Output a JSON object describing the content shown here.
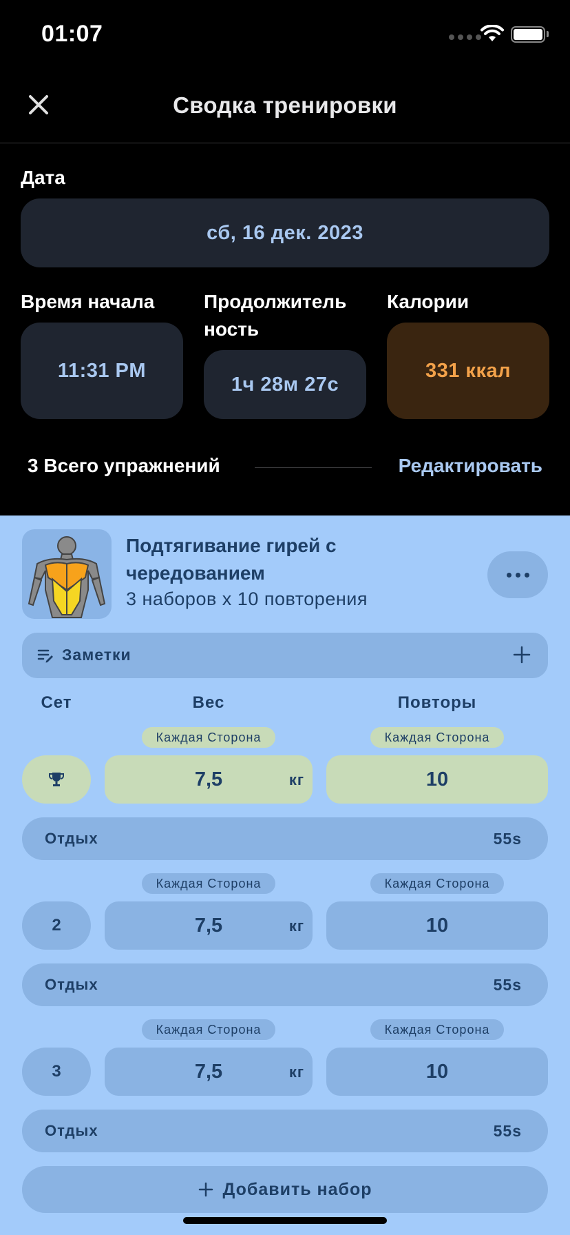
{
  "status_bar": {
    "time": "01:07"
  },
  "nav": {
    "title": "Сводка тренировки"
  },
  "date": {
    "label": "Дата",
    "value": "сб, 16 дек. 2023"
  },
  "stats": {
    "start_label": "Время начала",
    "start_value": "11:31 PM",
    "duration_label_1": "Продолжитель",
    "duration_label_2": "ность",
    "duration_value": "1ч 28м 27с",
    "calories_label": "Калории",
    "calories_value": "331 ккал"
  },
  "summary": {
    "total_label": "3 Всего упражнений",
    "edit_label": "Редактировать"
  },
  "exercise": {
    "title": "Подтягивание гирей с чередованием",
    "subtitle": "3 наборов x 10 повторения",
    "notes_label": "Заметки",
    "headers": {
      "set": "Сет",
      "weight": "Вес",
      "reps": "Повторы"
    },
    "side_tag": "Каждая Сторона",
    "unit": "кг",
    "sets": [
      {
        "set": "",
        "weight": "7,5",
        "reps": "10",
        "rest_label": "Отдых",
        "rest": "55s"
      },
      {
        "set": "2",
        "weight": "7,5",
        "reps": "10",
        "rest_label": "Отдых",
        "rest": "55s"
      },
      {
        "set": "3",
        "weight": "7,5",
        "reps": "10",
        "rest_label": "Отдых",
        "rest": "55s"
      }
    ],
    "add_set_label": "Добавить набор"
  },
  "colors": {
    "background": "#000000",
    "tile": "#1f2530",
    "accent_blue": "#a9c8f0",
    "calories": "#f3a24a",
    "card": "#a3cbfa",
    "highlight": "#c8dbb8"
  },
  "icons": [
    "close-icon",
    "wifi-icon",
    "battery-icon",
    "more-icon",
    "notes-icon",
    "plus-icon",
    "trophy-icon"
  ]
}
